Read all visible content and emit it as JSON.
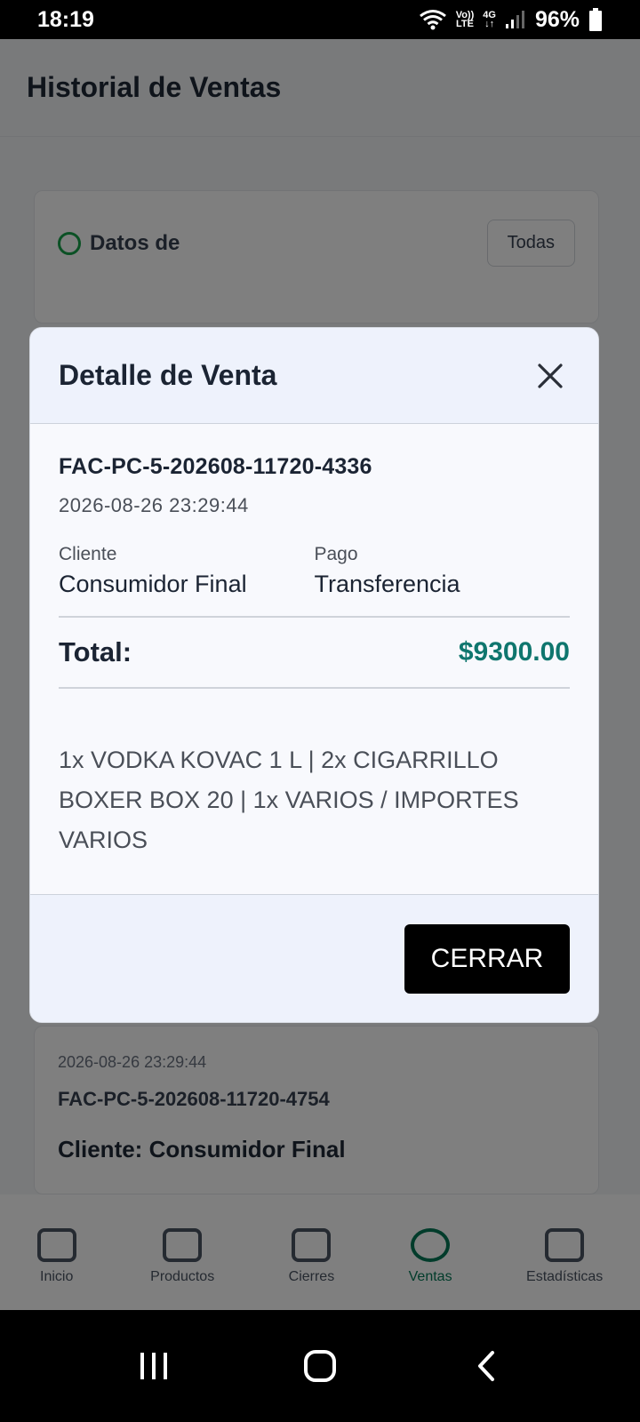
{
  "status_bar": {
    "time": "18:19",
    "volte_top": "Vo))",
    "volte_bottom": "LTE",
    "network": "4G",
    "battery": "96%"
  },
  "background": {
    "title": "Historial de Ventas",
    "filter_label": "Datos de",
    "filter_button": "Todas",
    "sale_date": "2026-08-26 23:29:44",
    "sale_invoice": "FAC-PC-5-202608-11720-4754",
    "sale_client": "Cliente: Consumidor Final",
    "nav": [
      "Inicio",
      "Productos",
      "Cierres",
      "Ventas",
      "Estadísticas"
    ]
  },
  "modal": {
    "title": "Detalle de Venta",
    "invoice_number": "FAC-PC-5-202608-11720-4336",
    "date": "2026-08-26 23:29:44",
    "client_label": "Cliente",
    "client_value": "Consumidor Final",
    "payment_label": "Pago",
    "payment_value": "Transferencia",
    "total_label": "Total:",
    "total_value": "$9300.00",
    "items": "1x VODKA KOVAC 1 L | 2x CIGARRILLO BOXER BOX 20 | 1x VARIOS / IMPORTES VARIOS",
    "close_button": "CERRAR"
  },
  "colors": {
    "total_accent": "#0f766e",
    "button_bg": "#000000"
  }
}
